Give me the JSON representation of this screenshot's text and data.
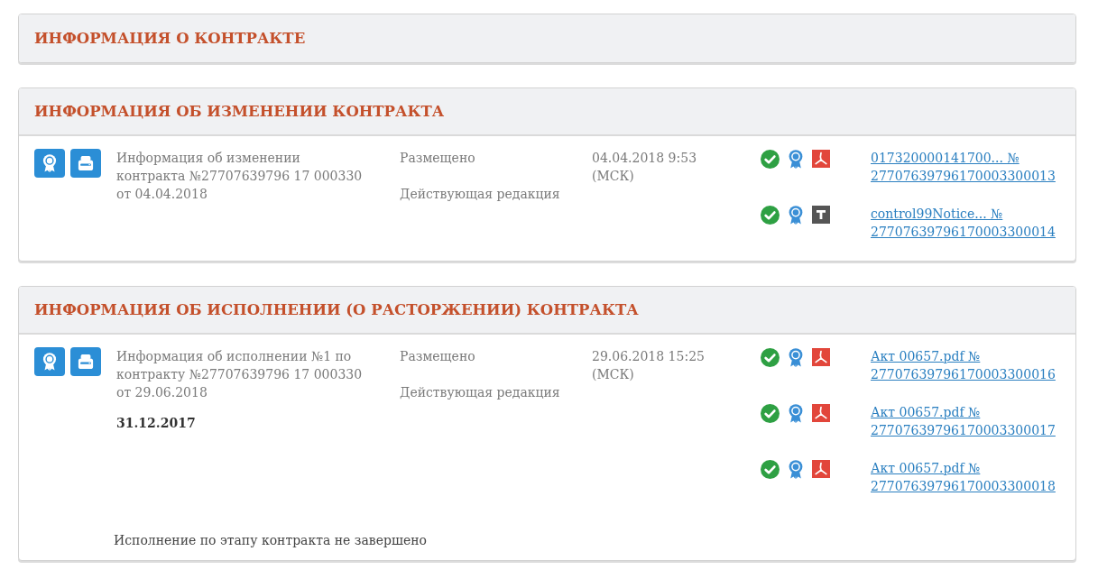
{
  "sections": [
    {
      "title": "ИНФОРМАЦИЯ О КОНТРАКТЕ"
    },
    {
      "title": "ИНФОРМАЦИЯ ОБ ИЗМЕНЕНИИ КОНТРАКТА",
      "records": [
        {
          "description": "Информация об изменении контракта №27707639796 17 000330 от 04.04.2018",
          "status": "Размещено",
          "edition": "Действующая редакция",
          "published": "04.04.2018 9:53 (МСК)",
          "files": [
            {
              "kind": "pdf",
              "link": "017320000141700... № 27707639796170003300013"
            },
            {
              "kind": "text",
              "link": "control99Notice... № 27707639796170003300014"
            }
          ]
        }
      ]
    },
    {
      "title": "ИНФОРМАЦИЯ ОБ ИСПОЛНЕНИИ (О РАСТОРЖЕНИИ) КОНТРАКТА",
      "records": [
        {
          "description": "Информация об исполнении №1 по контракту №27707639796 17 000330 от 29.06.2018",
          "stage_date": "31.12.2017",
          "status": "Размещено",
          "edition": "Действующая редакция",
          "published": "29.06.2018 15:25 (МСК)",
          "files": [
            {
              "kind": "pdf",
              "link": "Акт 00657.pdf № 27707639796170003300016"
            },
            {
              "kind": "pdf",
              "link": "Акт 00657.pdf № 27707639796170003300017"
            },
            {
              "kind": "pdf",
              "link": "Акт 00657.pdf № 27707639796170003300018"
            }
          ]
        }
      ],
      "note": "Исполнение по этапу контракта не завершено"
    }
  ]
}
